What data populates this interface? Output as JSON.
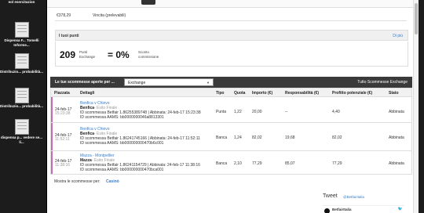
{
  "desktop": {
    "icons": [
      {
        "label": "eol esercitazion"
      },
      {
        "label": "Dispensa F... Tomelli Informe..."
      },
      {
        "label": "Distribuzio... probabilità..."
      },
      {
        "label": "Distribuzio... probabilità..."
      },
      {
        "label": "dispensa p... vedere se... li..."
      }
    ]
  },
  "vincita": {
    "amount": "€378,29",
    "label": "Vincita (prelevabili)"
  },
  "punti": {
    "title": "I tuoi punti",
    "link": "Di più",
    "points": "209",
    "points_label_1": "Punti",
    "points_label_2": "Exchange",
    "equation": "= 0%",
    "discount_1": "Sconto",
    "discount_2": "commissione"
  },
  "bets": {
    "title": "Le tue scommesse aperte per ...",
    "select_value": "Exchange",
    "all_link": "Tutto Scommesse Exchange",
    "headers": [
      "Piazzata",
      "Dettagli",
      "Tipo",
      "Quota",
      "Importo (€)",
      "Responsabilità (€)",
      "Profitto potenziale (€)",
      "Stato"
    ],
    "rows": [
      {
        "date": "24-feb-17",
        "time": "15:23:38",
        "event": "Benfica v Chievo",
        "selection": "Benfica",
        "market": "- Esito Finale",
        "id_line": "ID scommessa Betfair 1.86255389748 | Abbinata: 24-feb-17 15:23:38",
        "aams_line": "ID scommessa AAMS: bb0000000046a8813301",
        "type": "Punta",
        "odds": "1,22",
        "stake": "20,00",
        "liability": "--",
        "profit": "4,40",
        "status": "Abbinata"
      },
      {
        "date": "24-feb-17",
        "time": "11:52:11",
        "event": "Benfica v Chievo",
        "selection": "Benfica",
        "market": "- Esito Finale",
        "id_line": "ID scommessa Betfair 1.86241745166 | Abbinata: 24-feb-17 11:52:11",
        "aams_line": "ID scommessa AAMS: bb000000000470b6c001",
        "type": "Banca",
        "odds": "1,24",
        "stake": "82,02",
        "liability": "19,68",
        "profit": "82,02",
        "status": "Abbinata"
      },
      {
        "date": "24-feb-17",
        "time": "11:38:16",
        "event": "Mazza - Montpellier",
        "selection": "Mazza",
        "market": "- Esito Finale",
        "id_line": "ID scommessa Betfair 1.86241154729 | Abbinata: 24-feb-17 11:38:16",
        "aams_line": "ID scommessa AAMS: bb000000000470bca001",
        "type": "Banca",
        "odds": "2,10",
        "stake": "77,29",
        "liability": "85,07",
        "profit": "77,29",
        "status": "Abbinata"
      }
    ],
    "footer_text": "Mostra le scommesse per:",
    "footer_link": "Casinò"
  },
  "tweet": {
    "title": "Tweet",
    "handle": "@Betfairitalia"
  },
  "betfair": {
    "name": "BetfairItalia",
    "verified_icon": "verified-badge-icon",
    "bird_icon": "twitter-bird-icon"
  },
  "colors": {
    "link": "#3b7ec6",
    "header_bar": "#3a3a3a",
    "accent": "#c86ab5"
  }
}
